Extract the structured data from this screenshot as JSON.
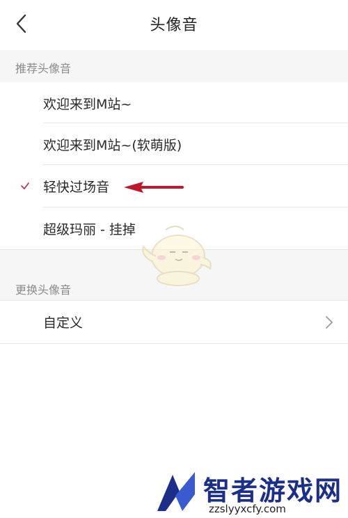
{
  "header": {
    "title": "头像音",
    "back_icon": "chevron-left-icon"
  },
  "recommended": {
    "section_label": "推荐头像音",
    "items": [
      {
        "label": "欢迎来到M站~",
        "selected": false
      },
      {
        "label": "欢迎来到M站~(软萌版)",
        "selected": false
      },
      {
        "label": "轻快过场音",
        "selected": true
      },
      {
        "label": "超级玛丽 - 挂掉",
        "selected": false
      }
    ]
  },
  "change": {
    "section_label": "更换头像音",
    "items": [
      {
        "label": "自定义",
        "icon": "chevron-right-icon"
      }
    ]
  },
  "watermark": {
    "site_name": "智者游戏网",
    "url": "zzslyyxcfy.com"
  },
  "colors": {
    "check": "#c0394a",
    "annotation_arrow": "#c0182a",
    "section_bg": "#f6f6f6",
    "watermark_text": "#1b2f8a"
  }
}
